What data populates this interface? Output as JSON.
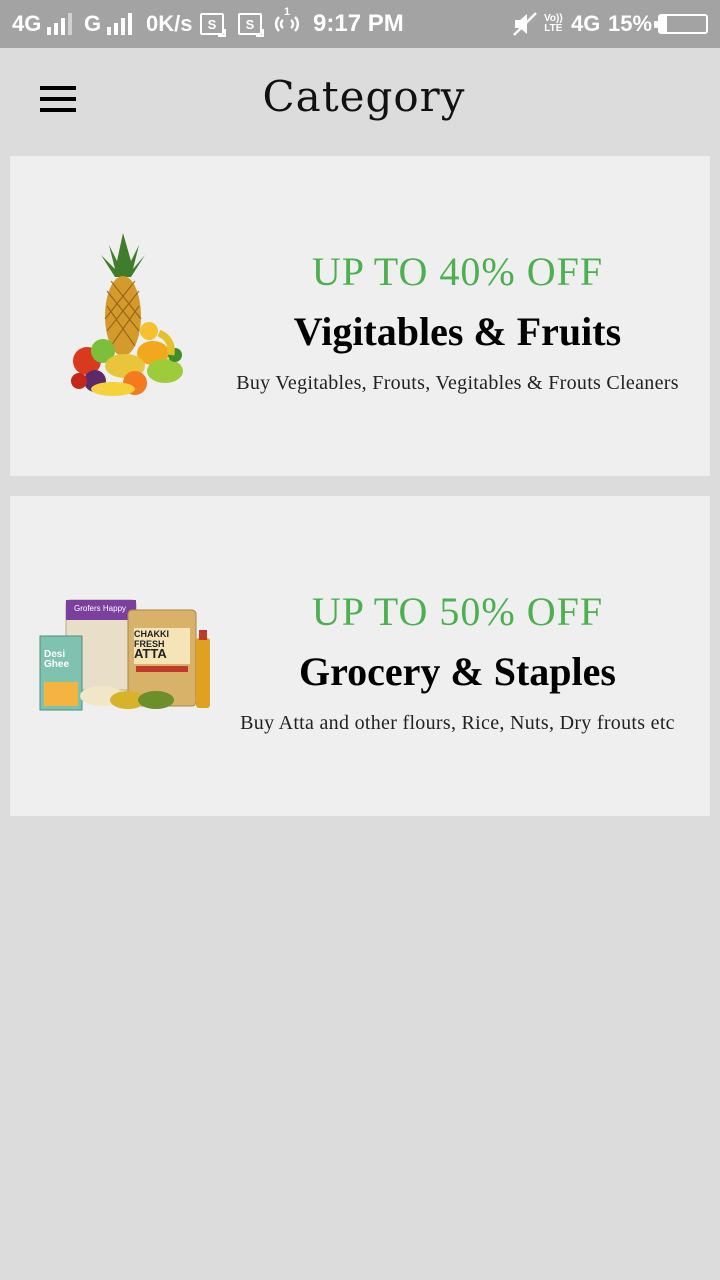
{
  "status_bar": {
    "network1": "4G",
    "network2": "G",
    "speed": "0K/s",
    "s_icon_label": "S",
    "hotspot_label": "1",
    "time": "9:17 PM",
    "volte_top": "Vo))",
    "volte_bottom": "LTE",
    "network3": "4G",
    "battery": "15%",
    "battery_level": 0.15
  },
  "header": {
    "title": "Category",
    "menu_icon": "hamburger-menu-icon"
  },
  "categories": [
    {
      "discount": "UP TO 40% OFF",
      "title": "Vigitables & Fruits",
      "description": "Buy Vegitables, Frouts, Vegitables & Frouts Cleaners",
      "image_icon": "fruits-basket-image",
      "accent": "#4caf50"
    },
    {
      "discount": "UP TO 50% OFF",
      "title": "Grocery & Staples",
      "description": "Buy Atta and other flours, Rice, Nuts, Dry frouts etc",
      "image_icon": "grocery-products-image",
      "accent": "#4caf50",
      "packs": {
        "rice_brand": "Grofers Happy",
        "atta_line1": "CHAKKI",
        "atta_line2": "FRESH",
        "atta_line3": "ATTA",
        "ghee_line1": "Desi",
        "ghee_line2": "Ghee"
      }
    }
  ]
}
